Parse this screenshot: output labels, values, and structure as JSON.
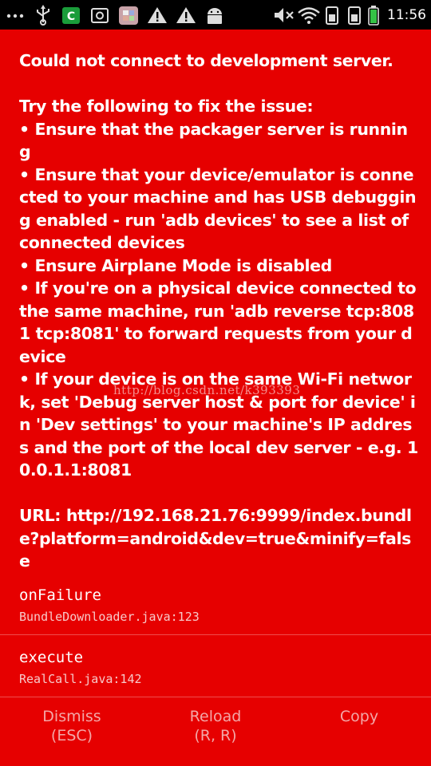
{
  "status_bar": {
    "time": "11:56",
    "left_icons": [
      "more-dots-icon",
      "usb-icon",
      "app-icon",
      "screenshot-icon",
      "gallery-icon",
      "warning-icon",
      "warning-icon",
      "android-icon"
    ],
    "right_icons": [
      "mute-icon",
      "wifi-icon",
      "phone-icon",
      "phone-icon",
      "battery-icon"
    ]
  },
  "error": {
    "title": "Could not connect to development server.",
    "try_heading": "Try the following to fix the issue:",
    "bullets": [
      "• Ensure that the packager server is running",
      "• Ensure that your device/emulator is connected to your machine and has USB debugging enabled - run 'adb devices' to see a list of connected devices",
      "• Ensure Airplane Mode is disabled",
      "• If you're on a physical device connected to the same machine, run 'adb reverse tcp:8081 tcp:8081' to forward requests from your device",
      "• If your device is on the same Wi-Fi network, set 'Debug server host & port for device' in 'Dev settings' to your machine's IP address and the port of the local dev server - e.g. 10.0.1.1:8081"
    ],
    "url_line": "URL: http://192.168.21.76:9999/index.bundle?platform=android&dev=true&minify=false"
  },
  "watermark": "http://blog.csdn.net/k393393",
  "stack_frames": [
    {
      "method": "onFailure",
      "file": "BundleDownloader.java:123"
    },
    {
      "method": "execute",
      "file": "RealCall.java:142"
    }
  ],
  "buttons": {
    "dismiss": {
      "label": "Dismiss",
      "shortcut": "(ESC)"
    },
    "reload": {
      "label": "Reload",
      "shortcut": "(R, R)"
    },
    "copy": {
      "label": "Copy"
    }
  },
  "colors": {
    "background": "#e60000",
    "button_text": "#f3a7a7",
    "divider": "#ef4d4d"
  }
}
